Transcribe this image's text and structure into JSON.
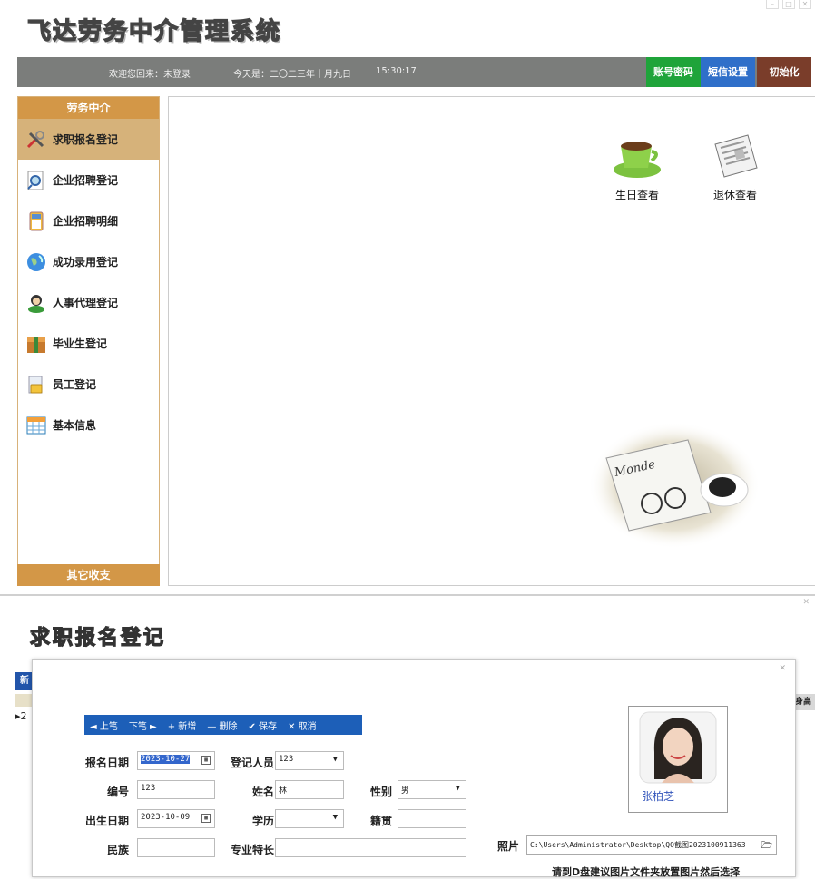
{
  "app": {
    "title": "飞达劳务中介管理系统",
    "window_controls": [
      "–",
      "□",
      "✕"
    ]
  },
  "status_bar": {
    "welcome": "欢迎您回来：未登录",
    "date": "今天是：二〇二三年十月九日",
    "time": "15:30:17",
    "buttons": {
      "account_password": "账号密码",
      "sms_settings": "短信设置",
      "initialize": "初始化"
    },
    "colors": {
      "bar": "#7b7d7b",
      "account": "#1fa43a",
      "sms": "#2f6fc9",
      "init": "#7a3d2a"
    }
  },
  "sidebar": {
    "header": "劳务中介",
    "footer": "其它收支",
    "items": [
      {
        "label": "求职报名登记",
        "icon": "tools-icon",
        "active": true
      },
      {
        "label": "企业招聘登记",
        "icon": "magnifier-icon"
      },
      {
        "label": "企业招聘明细",
        "icon": "calculator-icon"
      },
      {
        "label": "成功录用登记",
        "icon": "globe-icon"
      },
      {
        "label": "人事代理登记",
        "icon": "users-icon"
      },
      {
        "label": "毕业生登记",
        "icon": "gift-box-icon"
      },
      {
        "label": "员工登记",
        "icon": "user-lock-icon"
      },
      {
        "label": "基本信息",
        "icon": "table-icon"
      }
    ]
  },
  "main": {
    "shortcuts": [
      {
        "label": "生日查看",
        "icon": "coffee-cup-icon"
      },
      {
        "label": "退休查看",
        "icon": "newspaper-icon"
      }
    ],
    "decoration_text": "Monde"
  },
  "form_window": {
    "heading": "求职报名登记",
    "bg_tab_label": "新",
    "bg_column_label": "身高",
    "toolbar": {
      "prev": "◄ 上笔",
      "next": "下笔 ►",
      "add": "+ 新增",
      "delete": "— 删除",
      "save": "✔ 保存",
      "cancel": "✕ 取消"
    },
    "fields": {
      "signup_date": {
        "label": "报名日期",
        "value": "2023-10-27"
      },
      "registrar": {
        "label": "登记人员",
        "value": "123"
      },
      "number": {
        "label": "编号",
        "value": "123"
      },
      "name": {
        "label": "姓名",
        "value": "林"
      },
      "gender": {
        "label": "性别",
        "value": "男"
      },
      "birth_date": {
        "label": "出生日期",
        "value": "2023-10-09"
      },
      "education": {
        "label": "学历",
        "value": ""
      },
      "native_place": {
        "label": "籍贯",
        "value": ""
      },
      "ethnicity": {
        "label": "民族",
        "value": ""
      },
      "specialty": {
        "label": "专业特长",
        "value": ""
      }
    },
    "photo": {
      "label": "照片",
      "person_name": "张柏芝",
      "path": "C:\\Users\\Administrator\\Desktop\\QQ截图2023100911363",
      "note": "请到D盘建议图片文件夹放置图片然后选择"
    }
  }
}
